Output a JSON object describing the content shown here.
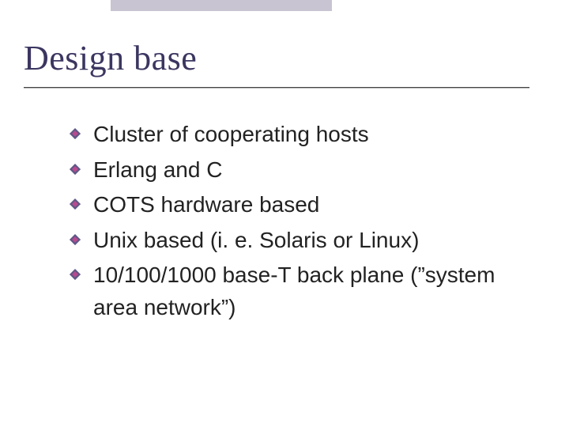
{
  "slide": {
    "title": "Design base",
    "bullets": [
      "Cluster of cooperating hosts",
      "Erlang and C",
      "COTS hardware based",
      "Unix based (i. e. Solaris or Linux)",
      "10/100/1000 base-T back plane (”system area network”)"
    ]
  },
  "theme": {
    "title_color": "#3b3660",
    "accent_bar_color": "#c9c4d2",
    "bullet_outer": "#5e5886",
    "bullet_inner": "#b74a8f"
  }
}
